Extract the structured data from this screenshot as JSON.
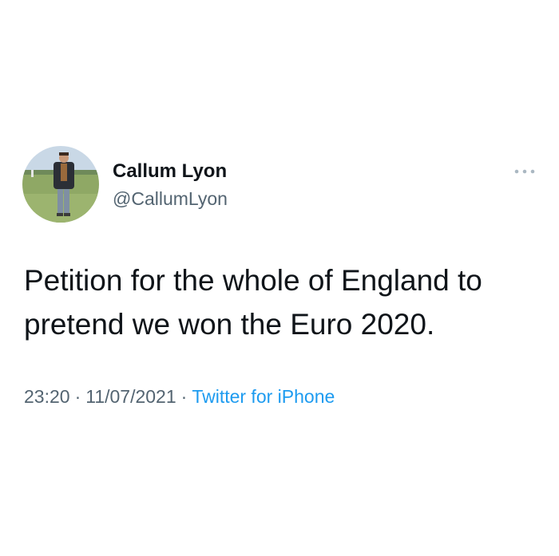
{
  "tweet": {
    "author": {
      "display_name": "Callum Lyon",
      "handle": "@CallumLyon"
    },
    "text_line_1": "Petition for the whole of England to",
    "text_line_2": "pretend we won the Euro 2020.",
    "time": "23:20",
    "date": "11/07/2021",
    "source": "Twitter for iPhone",
    "separator": "·",
    "more_icon": "more-horizontal-icon"
  },
  "colors": {
    "text_primary": "#0f1419",
    "text_secondary": "#536471",
    "link": "#1d9bf0",
    "background": "#ffffff"
  }
}
